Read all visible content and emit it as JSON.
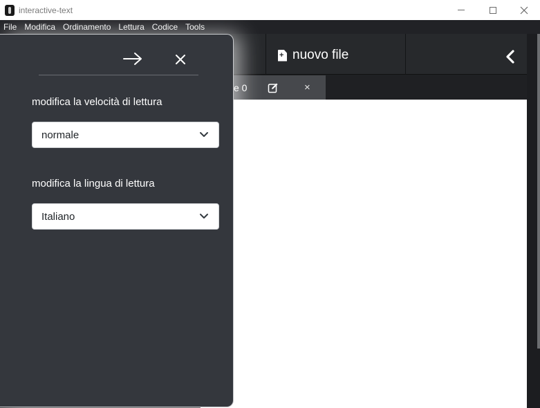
{
  "window": {
    "title": "interactive-text"
  },
  "menu": [
    "File",
    "Modifica",
    "Ordinamento",
    "Lettura",
    "Codice",
    "Tools"
  ],
  "toolbar": {
    "new_file_label": "nuovo file"
  },
  "tab": {
    "label": "e 0",
    "close_glyph": "×"
  },
  "settings": {
    "speed_label": "modifica la velocità di lettura",
    "speed_value": "normale",
    "language_label": "modifica la lingua di lettura",
    "language_value": "Italiano"
  },
  "icons": {
    "app": "app-icon",
    "minimize": "minimize-icon",
    "maximize": "maximize-icon",
    "close": "close-icon",
    "new_file": "file-plus-icon",
    "collapse": "chevron-left-icon",
    "edit": "edit-icon",
    "forward": "arrow-right-icon",
    "drawer_close": "x-icon",
    "dropdown": "chevron-down-icon"
  },
  "colors": {
    "menubar": "#212226",
    "app_background": "#1f2023",
    "drawer": "#34373d",
    "tab_active": "#46484c"
  }
}
